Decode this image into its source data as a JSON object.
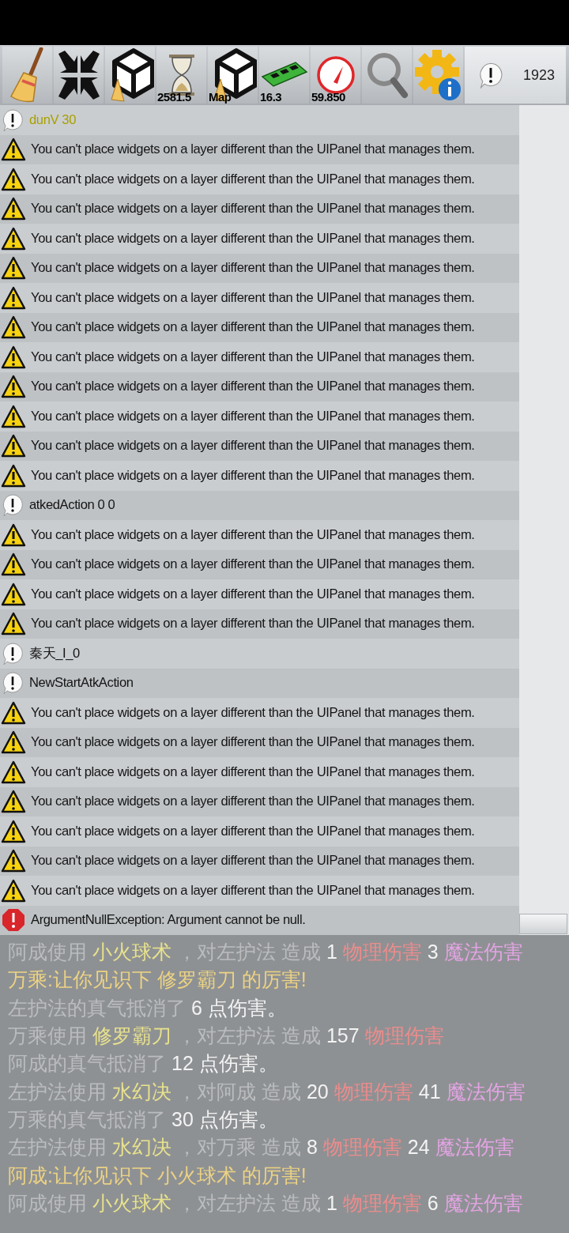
{
  "toolbar": {
    "buttons": [
      {
        "kind": "clear"
      },
      {
        "kind": "collapse"
      },
      {
        "kind": "unity-clear"
      },
      {
        "kind": "time",
        "label": "2581.5"
      },
      {
        "kind": "scene",
        "label": "Map"
      },
      {
        "kind": "memory",
        "label": "16.3"
      },
      {
        "kind": "fps",
        "label": "59.850"
      },
      {
        "kind": "search"
      },
      {
        "kind": "settings"
      }
    ],
    "counter": "1923"
  },
  "log": [
    {
      "kind": "info",
      "text": "dunV 30",
      "highlighted": true
    },
    {
      "kind": "warning",
      "text": "You can't place widgets on a layer different than the UIPanel that manages them.",
      "highlighted": false
    },
    {
      "kind": "warning",
      "text": "You can't place widgets on a layer different than the UIPanel that manages them.",
      "highlighted": false
    },
    {
      "kind": "warning",
      "text": "You can't place widgets on a layer different than the UIPanel that manages them.",
      "highlighted": false
    },
    {
      "kind": "warning",
      "text": "You can't place widgets on a layer different than the UIPanel that manages them.",
      "highlighted": false
    },
    {
      "kind": "warning",
      "text": "You can't place widgets on a layer different than the UIPanel that manages them.",
      "highlighted": false
    },
    {
      "kind": "warning",
      "text": "You can't place widgets on a layer different than the UIPanel that manages them.",
      "highlighted": false
    },
    {
      "kind": "warning",
      "text": "You can't place widgets on a layer different than the UIPanel that manages them.",
      "highlighted": false
    },
    {
      "kind": "warning",
      "text": "You can't place widgets on a layer different than the UIPanel that manages them.",
      "highlighted": false
    },
    {
      "kind": "warning",
      "text": "You can't place widgets on a layer different than the UIPanel that manages them.",
      "highlighted": false
    },
    {
      "kind": "warning",
      "text": "You can't place widgets on a layer different than the UIPanel that manages them.",
      "highlighted": false
    },
    {
      "kind": "warning",
      "text": "You can't place widgets on a layer different than the UIPanel that manages them.",
      "highlighted": false
    },
    {
      "kind": "warning",
      "text": "You can't place widgets on a layer different than the UIPanel that manages them.",
      "highlighted": false
    },
    {
      "kind": "info",
      "text": "atkedAction 0 0",
      "highlighted": false
    },
    {
      "kind": "warning",
      "text": "You can't place widgets on a layer different than the UIPanel that manages them.",
      "highlighted": false
    },
    {
      "kind": "warning",
      "text": "You can't place widgets on a layer different than the UIPanel that manages them.",
      "highlighted": false
    },
    {
      "kind": "warning",
      "text": "You can't place widgets on a layer different than the UIPanel that manages them.",
      "highlighted": false
    },
    {
      "kind": "warning",
      "text": "You can't place widgets on a layer different than the UIPanel that manages them.",
      "highlighted": false
    },
    {
      "kind": "info",
      "text": "秦天_I_0",
      "highlighted": false
    },
    {
      "kind": "info",
      "text": "NewStartAtkAction",
      "highlighted": false
    },
    {
      "kind": "warning",
      "text": "You can't place widgets on a layer different than the UIPanel that manages them.",
      "highlighted": false
    },
    {
      "kind": "warning",
      "text": "You can't place widgets on a layer different than the UIPanel that manages them.",
      "highlighted": false
    },
    {
      "kind": "warning",
      "text": "You can't place widgets on a layer different than the UIPanel that manages them.",
      "highlighted": false
    },
    {
      "kind": "warning",
      "text": "You can't place widgets on a layer different than the UIPanel that manages them.",
      "highlighted": false
    },
    {
      "kind": "warning",
      "text": "You can't place widgets on a layer different than the UIPanel that manages them.",
      "highlighted": false
    },
    {
      "kind": "warning",
      "text": "You can't place widgets on a layer different than the UIPanel that manages them.",
      "highlighted": false
    },
    {
      "kind": "warning",
      "text": "You can't place widgets on a layer different than the UIPanel that manages them.",
      "highlighted": false
    },
    {
      "kind": "error",
      "text": "ArgumentNullException: Argument cannot be null.",
      "highlighted": false
    }
  ],
  "battle_log": [
    {
      "parts": [
        {
          "kind": "plain",
          "text": "阿成使用"
        },
        {
          "kind": "skill",
          "text": "小火球术"
        },
        {
          "kind": "plain",
          "text": "，对左护法 造成"
        },
        {
          "kind": "number",
          "text": "1"
        },
        {
          "kind": "physical",
          "text": "物理伤害"
        },
        {
          "kind": "number",
          "text": "3"
        },
        {
          "kind": "magic",
          "text": "魔法伤害"
        }
      ]
    },
    {
      "parts": [
        {
          "kind": "speech",
          "text": "万乘:让你见识下 修罗霸刀 的厉害!"
        }
      ]
    },
    {
      "parts": [
        {
          "kind": "plain",
          "text": "左护法的真气抵消了"
        },
        {
          "kind": "number",
          "text": "6 点伤害。"
        }
      ]
    },
    {
      "parts": [
        {
          "kind": "plain",
          "text": "万乘使用"
        },
        {
          "kind": "skill",
          "text": "修罗霸刀"
        },
        {
          "kind": "plain",
          "text": "，对左护法 造成"
        },
        {
          "kind": "number",
          "text": "157"
        },
        {
          "kind": "physical",
          "text": "物理伤害"
        }
      ]
    },
    {
      "parts": [
        {
          "kind": "plain",
          "text": "阿成的真气抵消了"
        },
        {
          "kind": "number",
          "text": "12 点伤害。"
        }
      ]
    },
    {
      "parts": [
        {
          "kind": "plain",
          "text": "左护法使用"
        },
        {
          "kind": "skill",
          "text": "水幻决"
        },
        {
          "kind": "plain",
          "text": "，对阿成 造成"
        },
        {
          "kind": "number",
          "text": "20"
        },
        {
          "kind": "physical",
          "text": "物理伤害"
        },
        {
          "kind": "number",
          "text": "41"
        },
        {
          "kind": "magic",
          "text": "魔法伤害"
        }
      ]
    },
    {
      "parts": [
        {
          "kind": "plain",
          "text": "万乘的真气抵消了"
        },
        {
          "kind": "number",
          "text": "30 点伤害。"
        }
      ]
    },
    {
      "parts": [
        {
          "kind": "plain",
          "text": "左护法使用"
        },
        {
          "kind": "skill",
          "text": "水幻决"
        },
        {
          "kind": "plain",
          "text": "，对万乘 造成"
        },
        {
          "kind": "number",
          "text": "8"
        },
        {
          "kind": "physical",
          "text": "物理伤害"
        },
        {
          "kind": "number",
          "text": "24"
        },
        {
          "kind": "magic",
          "text": "魔法伤害"
        }
      ]
    },
    {
      "parts": [
        {
          "kind": "speech",
          "text": "阿成:让你见识下 小火球术 的厉害!"
        }
      ]
    },
    {
      "parts": [
        {
          "kind": "plain",
          "text": "阿成使用"
        },
        {
          "kind": "skill",
          "text": "小火球术"
        },
        {
          "kind": "plain",
          "text": "，对左护法 造成"
        },
        {
          "kind": "number",
          "text": "1"
        },
        {
          "kind": "physical",
          "text": "物理伤害"
        },
        {
          "kind": "number",
          "text": "6"
        },
        {
          "kind": "magic",
          "text": "魔法伤害"
        }
      ]
    }
  ]
}
